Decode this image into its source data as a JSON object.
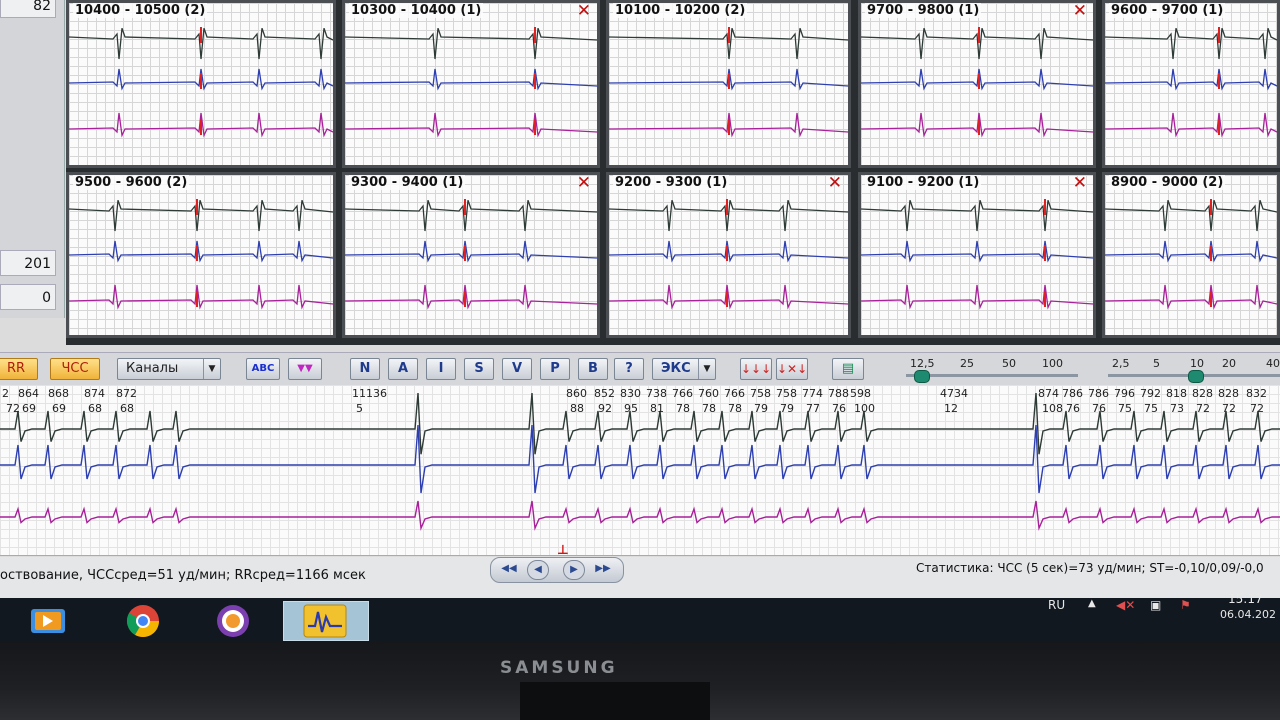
{
  "left_panel": {
    "values": [
      "82",
      "201",
      "0"
    ]
  },
  "tiles": [
    {
      "title": "10400 - 10500 (2)",
      "close": false
    },
    {
      "title": "10300 - 10400 (1)",
      "close": true
    },
    {
      "title": "10100 - 10200 (2)",
      "close": false
    },
    {
      "title": "9700 - 9800 (1)",
      "close": true
    },
    {
      "title": "9600 - 9700 (1)",
      "close": false
    },
    {
      "title": "9500 - 9600 (2)",
      "close": false
    },
    {
      "title": "9300 - 9400 (1)",
      "close": true
    },
    {
      "title": "9200 - 9300 (1)",
      "close": true
    },
    {
      "title": "9100 - 9200 (1)",
      "close": true
    },
    {
      "title": "8900 - 9000 (2)",
      "close": false
    }
  ],
  "tile_close_label": "✕",
  "toolbar": {
    "rr_label": "RR",
    "hr_label": "ЧСС",
    "channels_label": "Каналы",
    "abc_label": "ABC",
    "beat_buttons": [
      "N",
      "A",
      "I",
      "S",
      "V",
      "P",
      "B",
      "?"
    ],
    "eks_label": "ЭКС",
    "slider1_ticks": [
      "12,5",
      "25",
      "50",
      "100"
    ],
    "slider2_ticks": [
      "2,5",
      "5",
      "10",
      "20",
      "40"
    ]
  },
  "strip": {
    "rr_top": [
      "2",
      "864",
      "868",
      "874",
      "872",
      "11136",
      "860",
      "852",
      "830",
      "738",
      "766",
      "760",
      "766",
      "758",
      "758",
      "774",
      "788",
      "598",
      "4734",
      "874",
      "786",
      "786",
      "796",
      "792",
      "818",
      "828",
      "828",
      "832"
    ],
    "hr_bottom": [
      "72",
      "69",
      "69",
      "68",
      "68",
      "5",
      "88",
      "92",
      "95",
      "81",
      "78",
      "78",
      "78",
      "79",
      "79",
      "77",
      "76",
      "100",
      "12",
      "108",
      "76",
      "76",
      "75",
      "75",
      "73",
      "72",
      "72",
      "72"
    ],
    "marker": "⊥"
  },
  "status": {
    "left": "оствование,  ЧССсред=51 уд/мин;   RRсред=1166 мсек",
    "right": "Статистика: ЧСС (5 сек)=73 уд/мин; ST=-0,10/0,09/-0,0"
  },
  "taskbar": {
    "lang": "RU",
    "time": "15:17",
    "date": "06.04.202"
  },
  "monitor_brand": "SAMSUNG",
  "colors": {
    "lead1": "#2e3a36",
    "lead2": "#2d3fb0",
    "lead3": "#a8209a",
    "beat_mark": "#e02020"
  }
}
